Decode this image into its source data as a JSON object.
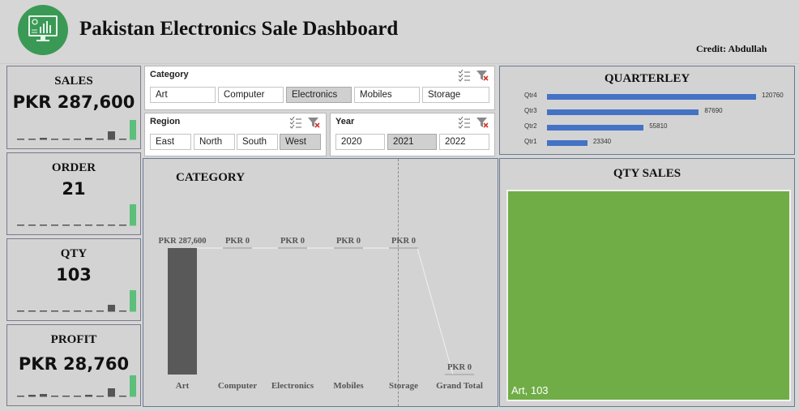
{
  "header": {
    "title": "Pakistan Electronics Sale Dashboard",
    "credit": "Credit: Abdullah",
    "logo_icon": "dashboard-monitor-icon"
  },
  "kpis": [
    {
      "label": "SALES",
      "value": "PKR 287,600"
    },
    {
      "label": "ORDER",
      "value": "21"
    },
    {
      "label": "QTY",
      "value": "103"
    },
    {
      "label": "PROFIT",
      "value": "PKR 28,760"
    }
  ],
  "slicers": {
    "category": {
      "title": "Category",
      "options": [
        "Art",
        "Computer",
        "Electronics",
        "Mobiles",
        "Storage"
      ],
      "selected": "Electronics"
    },
    "region": {
      "title": "Region",
      "options": [
        "East",
        "North",
        "South",
        "West"
      ],
      "selected": "West"
    },
    "year": {
      "title": "Year",
      "options": [
        "2020",
        "2021",
        "2022"
      ],
      "selected": "2021"
    }
  },
  "quarterly": {
    "title": "QUARTERLEY",
    "chart_data": {
      "type": "bar",
      "categories": [
        "Qtr4",
        "Qtr3",
        "Qtr2",
        "Qtr1"
      ],
      "values": [
        120760,
        87690,
        55810,
        23340
      ],
      "labels": [
        "120760",
        "87690",
        "55810",
        "23340"
      ]
    }
  },
  "category_chart": {
    "title": "CATEGORY",
    "chart_data": {
      "type": "bar",
      "categories": [
        "Art",
        "Computer",
        "Electronics",
        "Mobiles",
        "Storage",
        "Grand Total"
      ],
      "values": [
        287600,
        0,
        0,
        0,
        0,
        0
      ],
      "labels": [
        "PKR 287,600",
        "PKR 0",
        "PKR 0",
        "PKR 0",
        "PKR 0",
        "PKR 0"
      ]
    }
  },
  "qty_sales": {
    "title": "QTY SALES",
    "tile_label": "Art, 103",
    "color": "#70ad47"
  },
  "colors": {
    "accent_green": "#5cbf7a",
    "bar_dark": "#595959",
    "bar_blue": "#4472c4"
  }
}
